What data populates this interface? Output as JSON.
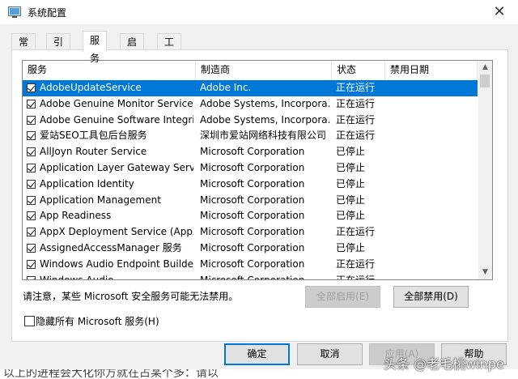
{
  "window": {
    "title": "系统配置",
    "close_glyph": "✕"
  },
  "tabs": [
    "常规",
    "引导",
    "服务",
    "启动",
    "工具"
  ],
  "active_tab": "服务",
  "table": {
    "headers": [
      "服务",
      "制造商",
      "状态",
      "禁用日期"
    ],
    "rows": [
      {
        "name": "AdobeUpdateService",
        "maker": "Adobe Inc.",
        "status": "正在运行",
        "date": "",
        "checked": true,
        "selected": true
      },
      {
        "name": "Adobe Genuine Monitor Service",
        "maker": "Adobe Systems, Incorpora...",
        "status": "正在运行",
        "date": "",
        "checked": true
      },
      {
        "name": "Adobe Genuine Software Integrit...",
        "maker": "Adobe Systems, Incorpora...",
        "status": "正在运行",
        "date": "",
        "checked": true
      },
      {
        "name": "爱站SEO工具包后台服务",
        "maker": "深圳市爱站网络科技有限公司",
        "status": "正在运行",
        "date": "",
        "checked": true
      },
      {
        "name": "AllJoyn Router Service",
        "maker": "Microsoft Corporation",
        "status": "已停止",
        "date": "",
        "checked": true
      },
      {
        "name": "Application Layer Gateway Service",
        "maker": "Microsoft Corporation",
        "status": "已停止",
        "date": "",
        "checked": true
      },
      {
        "name": "Application Identity",
        "maker": "Microsoft Corporation",
        "status": "已停止",
        "date": "",
        "checked": true
      },
      {
        "name": "Application Management",
        "maker": "Microsoft Corporation",
        "status": "已停止",
        "date": "",
        "checked": true
      },
      {
        "name": "App Readiness",
        "maker": "Microsoft Corporation",
        "status": "已停止",
        "date": "",
        "checked": true
      },
      {
        "name": "AppX Deployment Service (AppX...",
        "maker": "Microsoft Corporation",
        "status": "正在运行",
        "date": "",
        "checked": true
      },
      {
        "name": "AssignedAccessManager 服务",
        "maker": "Microsoft Corporation",
        "status": "已停止",
        "date": "",
        "checked": true
      },
      {
        "name": "Windows Audio Endpoint Builder",
        "maker": "Microsoft Corporation",
        "status": "正在运行",
        "date": "",
        "checked": true
      },
      {
        "name": "Windows Audio",
        "maker": "Microsoft Corporation",
        "status": "正在运行",
        "date": "",
        "checked": true
      }
    ]
  },
  "note": "请注意，某些 Microsoft 安全服务可能无法禁用。",
  "buttons": {
    "enable_all": "全部启用(E)",
    "disable_all": "全部禁用(D)",
    "ok": "确定",
    "cancel": "取消",
    "apply": "应用(A)",
    "help": "帮助"
  },
  "hide_ms": {
    "label": "隐藏所有 Microsoft 服务(H)",
    "checked": false
  },
  "background_text": "以上的进程会大化你方就在占某个多：请以",
  "watermark": "头条 @老毛桃winpe",
  "colors": {
    "selection": "#0078d7",
    "accent_border": "#0078d7"
  }
}
